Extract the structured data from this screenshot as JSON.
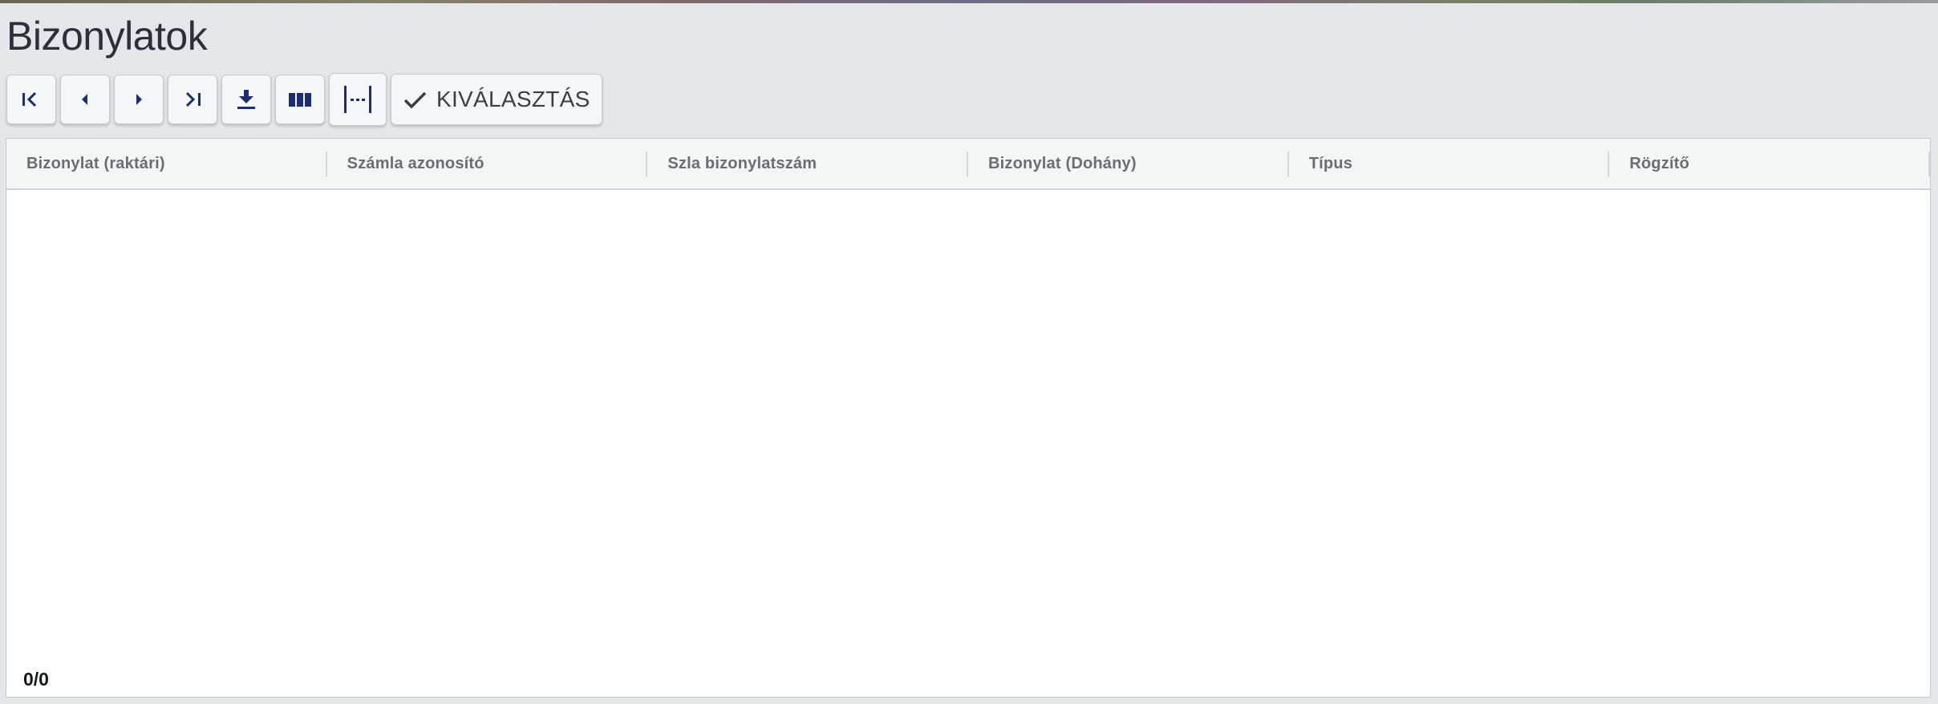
{
  "page": {
    "title": "Bizonylatok"
  },
  "toolbar": {
    "first_icon": "first-page-icon",
    "prev_icon": "previous-page-icon",
    "next_icon": "next-page-icon",
    "last_icon": "last-page-icon",
    "download_icon": "download-icon",
    "columns_icon": "columns-icon",
    "fit_icon": "fit-width-icon",
    "select_label": "KIVÁLASZTÁS",
    "select_icon": "check-icon"
  },
  "grid": {
    "columns": [
      {
        "label": "Bizonylat (raktári)"
      },
      {
        "label": "Számla azonosító"
      },
      {
        "label": "Szla bizonylatszám"
      },
      {
        "label": "Bizonylat (Dohány)"
      },
      {
        "label": "Típus"
      },
      {
        "label": "Rögzítő"
      }
    ],
    "rows": [],
    "count": "0/0"
  },
  "colors": {
    "background": "#e4e6ea",
    "icon_blue": "#1c2e6e",
    "header_bg": "#f4f5f5",
    "header_text": "#6a6d74"
  }
}
